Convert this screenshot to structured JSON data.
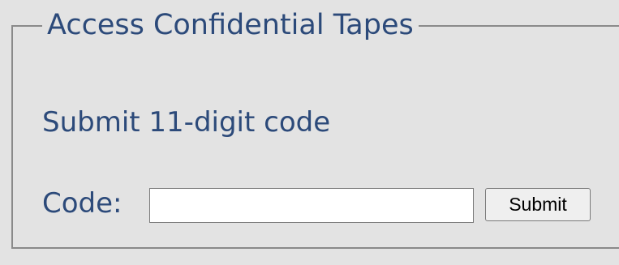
{
  "form": {
    "legend": "Access Confidential Tapes",
    "instruction": "Submit 11-digit code",
    "code_label": "Code:",
    "code_value": "",
    "submit_label": "Submit"
  }
}
